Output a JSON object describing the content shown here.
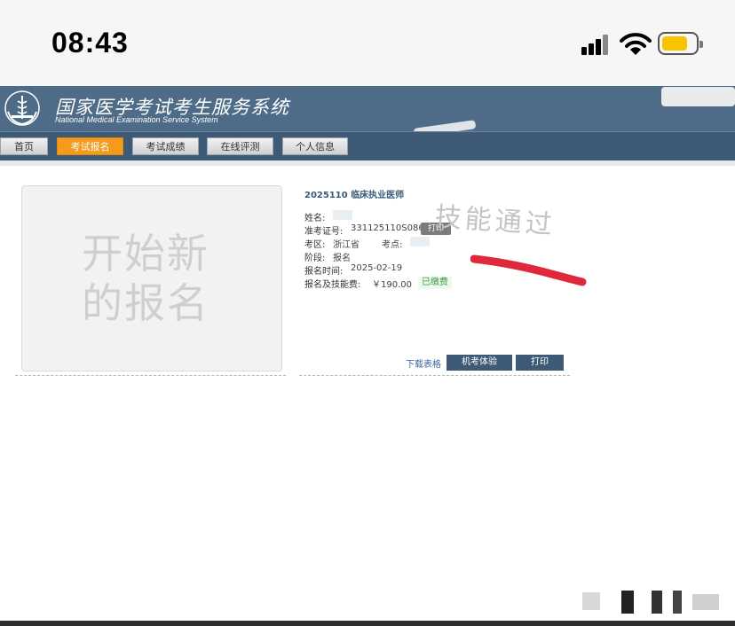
{
  "status_bar": {
    "time": "08:43"
  },
  "site": {
    "title": "国家医学考试考生服务系统",
    "subtitle": "National Medical Examination Service System"
  },
  "nav": {
    "items": [
      {
        "label": "首页"
      },
      {
        "label": "考试报名",
        "active": true
      },
      {
        "label": "考试成绩"
      },
      {
        "label": "在线评测"
      },
      {
        "label": "个人信息"
      }
    ]
  },
  "new_registration": {
    "text_line1": "开始新",
    "text_line2": "的报名"
  },
  "registration": {
    "exam": "2025110 临床执业医师",
    "name_label": "姓名:",
    "ticket_label": "准考证号:",
    "ticket_value": "331125110S0863",
    "print_small": "打印",
    "region_label": "考区:",
    "region_value": "浙江省",
    "site_label": "考点:",
    "stage_label": "阶段:",
    "stage_value": "报名",
    "time_label": "报名时间:",
    "time_value": "2025-02-19",
    "fee_label": "报名及技能费:",
    "fee_value": "￥190.00",
    "fee_status": "已缴费",
    "handwritten_note": "技能通过"
  },
  "actions": {
    "download": "下载表格",
    "mock_exam": "机考体验",
    "print": "打印"
  },
  "colors": {
    "header": "#4e6b87",
    "nav_active": "#f59b1c",
    "button": "#3e5a76",
    "paid": "#3c9b3c"
  }
}
